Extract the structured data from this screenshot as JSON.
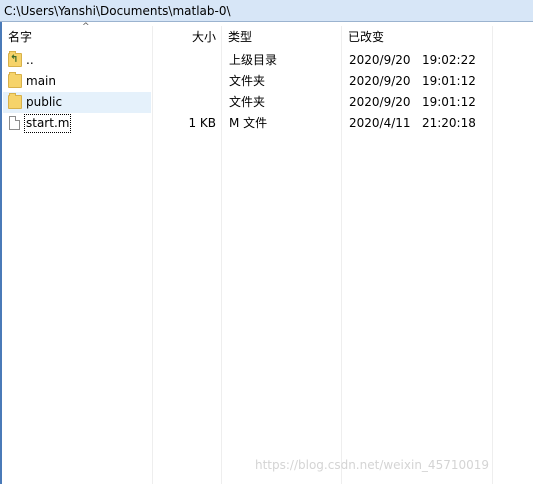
{
  "path": "C:\\Users\\Yanshi\\Documents\\matlab-0\\",
  "columns": {
    "name": "名字",
    "size": "大小",
    "type": "类型",
    "modified": "已改变"
  },
  "rows": [
    {
      "name": "..",
      "size": "",
      "type": "上级目录",
      "modified": "2020/9/20   19:02:22",
      "icon": "parent-folder-icon"
    },
    {
      "name": "main",
      "size": "",
      "type": "文件夹",
      "modified": "2020/9/20   19:01:12",
      "icon": "folder-icon"
    },
    {
      "name": "public",
      "size": "",
      "type": "文件夹",
      "modified": "2020/9/20   19:01:12",
      "icon": "folder-icon"
    },
    {
      "name": "start.m",
      "size": "1 KB",
      "type": "M 文件",
      "modified": "2020/4/11   21:20:18",
      "icon": "file-icon"
    }
  ],
  "watermark": "https://blog.csdn.net/weixin_45710019"
}
